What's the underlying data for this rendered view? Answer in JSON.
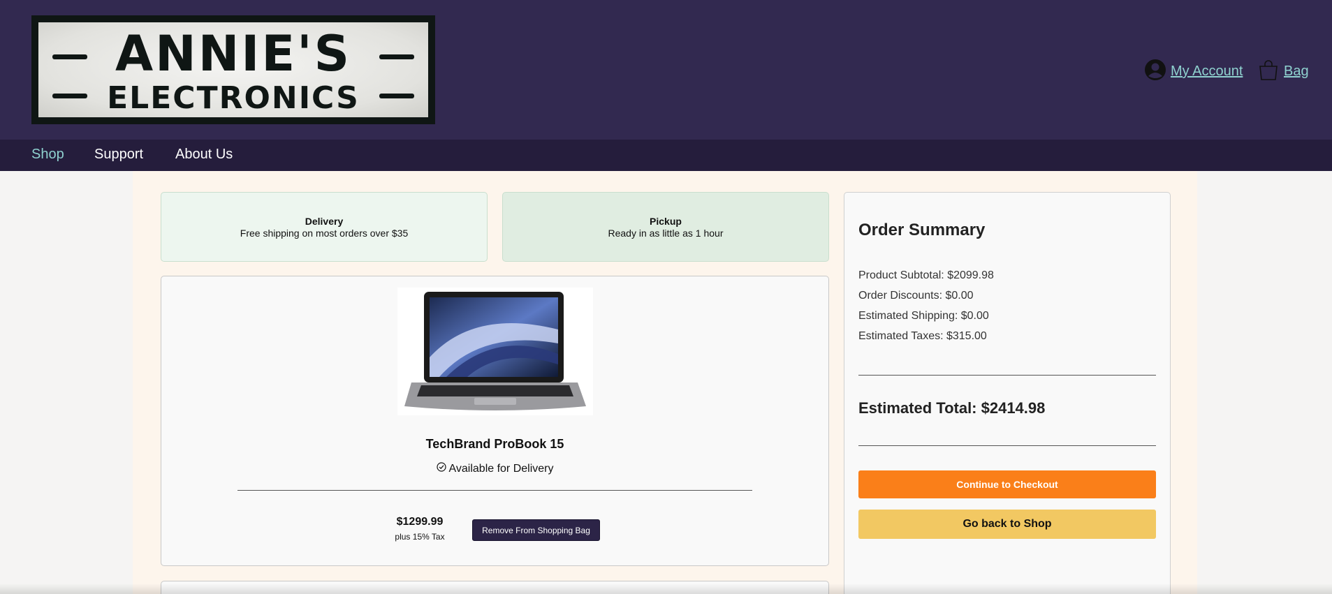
{
  "brand": {
    "logo_line1": "ANNIE'S",
    "logo_line2": "ELECTRONICS",
    "header_bg": "#322950",
    "accent": "#8fd1cf"
  },
  "header": {
    "account_label": "My Account",
    "account_icon": "user-circle-icon",
    "bag_label": "Bag",
    "bag_icon": "shopping-bag-icon"
  },
  "nav": {
    "items": [
      {
        "label": "Shop",
        "active": true
      },
      {
        "label": "Support",
        "active": false
      },
      {
        "label": "About Us",
        "active": false
      }
    ]
  },
  "fulfillment": {
    "delivery": {
      "title": "Delivery",
      "subtitle": "Free shipping on most orders over $35"
    },
    "pickup": {
      "title": "Pickup",
      "subtitle": "Ready in as little as 1 hour"
    }
  },
  "cart": {
    "items": [
      {
        "name": "TechBrand ProBook 15",
        "availability": "Available for Delivery",
        "availability_icon": "check-circle-icon",
        "price": "$1299.99",
        "tax_note": "plus 15% Tax",
        "remove_label": "Remove From Shopping Bag"
      }
    ]
  },
  "summary": {
    "title": "Order Summary",
    "subtotal": "Product Subtotal: $2099.98",
    "discounts": "Order Discounts: $0.00",
    "shipping": "Estimated Shipping: $0.00",
    "taxes": "Estimated Taxes: $315.00",
    "total": "Estimated Total: $2414.98",
    "checkout_label": "Continue to Checkout",
    "back_label": "Go back to Shop"
  }
}
